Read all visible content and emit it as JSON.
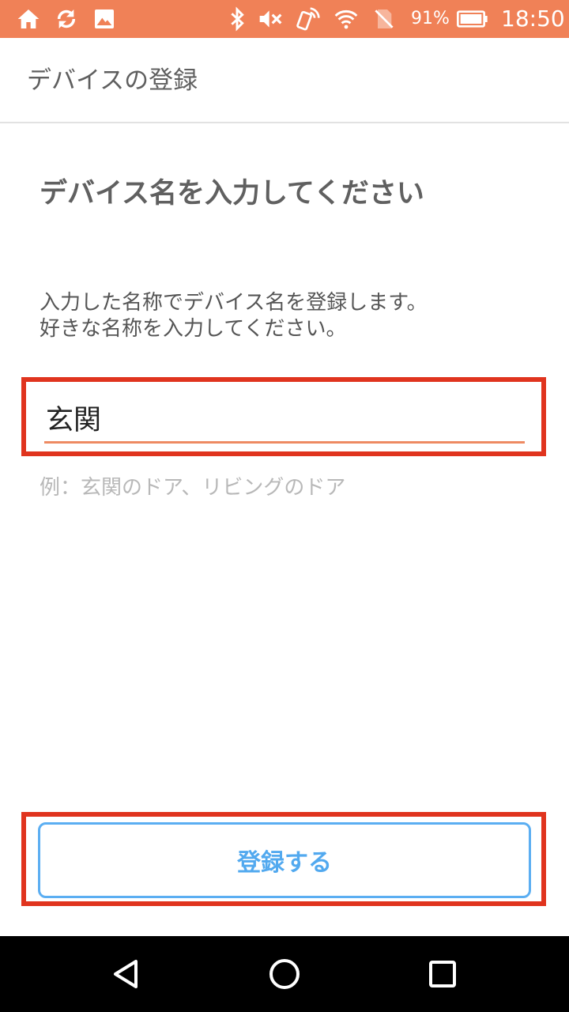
{
  "status_bar": {
    "color": "#F08157",
    "battery_percent": "91%",
    "time": "18:50",
    "left_icons": [
      "home-icon",
      "sync-icon",
      "image-icon"
    ],
    "right_icons": [
      "bluetooth-icon",
      "mute-icon",
      "nfc-icon",
      "wifi-icon",
      "no-sim-icon",
      "battery-icon"
    ]
  },
  "app_bar": {
    "title": "デバイスの登録"
  },
  "main": {
    "heading": "デバイス名を入力してください",
    "description_line1": "入力した名称でデバイス名を登録します。",
    "description_line2": "好きな名称を入力してください。",
    "name_input_value": "玄関",
    "hint": "例：玄関のドア、リビングのドア",
    "register_button": "登録する"
  },
  "colors": {
    "accent": "#F08157",
    "highlight": "#E0341E",
    "button": "#52A9EF"
  },
  "nav_bar": {
    "icons": [
      "back-icon",
      "home-circle-icon",
      "recents-icon"
    ]
  }
}
